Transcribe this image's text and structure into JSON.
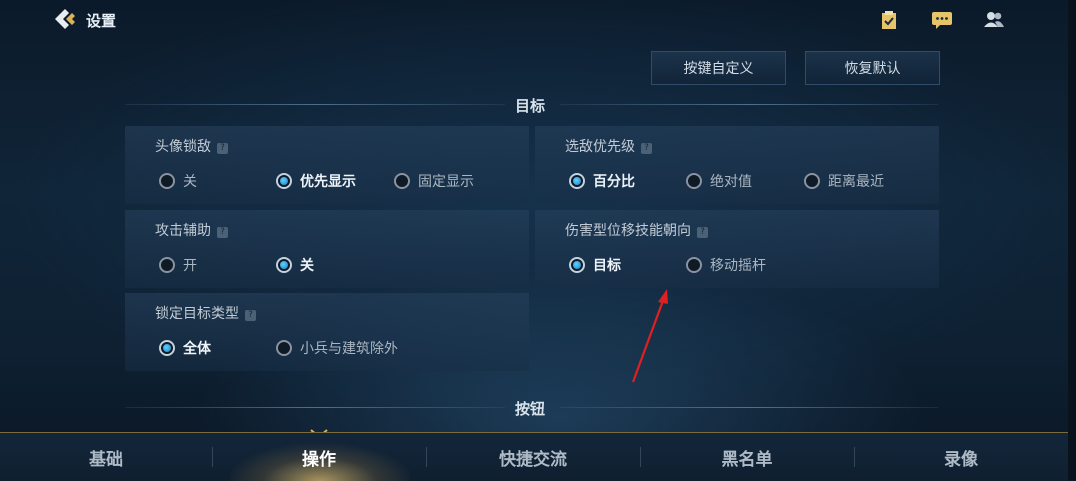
{
  "header": {
    "title": "设置"
  },
  "actions": {
    "custom_keys": "按键自定义",
    "restore_default": "恢复默认"
  },
  "sections": {
    "target": "目标",
    "buttons": "按钮"
  },
  "cards": [
    {
      "title": "头像锁敌",
      "options": [
        "关",
        "优先显示",
        "固定显示"
      ],
      "selected": 1
    },
    {
      "title": "选敌优先级",
      "options": [
        "百分比",
        "绝对值",
        "距离最近"
      ],
      "selected": 0
    },
    {
      "title": "攻击辅助",
      "options": [
        "开",
        "关"
      ],
      "selected": 1
    },
    {
      "title": "伤害型位移技能朝向",
      "options": [
        "目标",
        "移动摇杆"
      ],
      "selected": 0
    },
    {
      "title": "锁定目标类型",
      "options": [
        "全体",
        "小兵与建筑除外"
      ],
      "selected": 0
    }
  ],
  "tabs": [
    "基础",
    "操作",
    "快捷交流",
    "黑名单",
    "录像"
  ],
  "active_tab": 1,
  "help_mark": "?",
  "colors": {
    "accent_gold": "#d9b25a",
    "radio_blue": "#2fa6e8",
    "annotation_red": "#e02020"
  }
}
